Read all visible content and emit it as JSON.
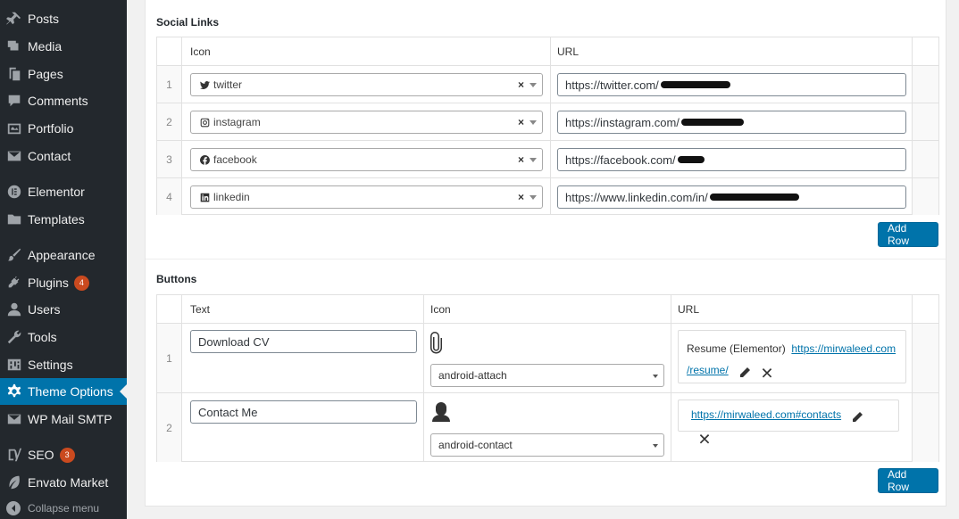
{
  "sidebar": {
    "items": [
      {
        "label": "Posts",
        "icon": "pushpin-icon"
      },
      {
        "label": "Media",
        "icon": "media-icon"
      },
      {
        "label": "Pages",
        "icon": "pages-icon"
      },
      {
        "label": "Comments",
        "icon": "comments-icon"
      },
      {
        "label": "Portfolio",
        "icon": "portfolio-icon"
      },
      {
        "label": "Contact",
        "icon": "envelope-icon"
      },
      {
        "label": "Elementor",
        "icon": "elementor-icon"
      },
      {
        "label": "Templates",
        "icon": "folder-icon"
      },
      {
        "label": "Appearance",
        "icon": "brush-icon"
      },
      {
        "label": "Plugins",
        "icon": "plug-icon",
        "badge": "4"
      },
      {
        "label": "Users",
        "icon": "user-icon"
      },
      {
        "label": "Tools",
        "icon": "wrench-icon"
      },
      {
        "label": "Settings",
        "icon": "settings-icon"
      },
      {
        "label": "Theme Options",
        "icon": "gear-icon",
        "active": true
      },
      {
        "label": "WP Mail SMTP",
        "icon": "mail-icon"
      },
      {
        "label": "SEO",
        "icon": "yoast-icon",
        "badge": "3"
      },
      {
        "label": "Envato Market",
        "icon": "leaf-icon"
      }
    ],
    "collapse_label": "Collapse menu"
  },
  "social": {
    "title": "Social Links",
    "col_icon": "Icon",
    "col_url": "URL",
    "rows": [
      {
        "num": "1",
        "icon_label": "twitter",
        "icon": "twitter-icon",
        "url": "https://twitter.com/"
      },
      {
        "num": "2",
        "icon_label": "instagram",
        "icon": "instagram-icon",
        "url": "https://instagram.com/"
      },
      {
        "num": "3",
        "icon_label": "facebook",
        "icon": "facebook-icon",
        "url": "https://facebook.com/"
      },
      {
        "num": "4",
        "icon_label": "linkedin",
        "icon": "linkedin-icon",
        "url": "https://www.linkedin.com/in/"
      }
    ],
    "clear_symbol": "×",
    "add_row": "Add Row"
  },
  "buttons": {
    "title": "Buttons",
    "col_text": "Text",
    "col_icon": "Icon",
    "col_url": "URL",
    "rows": [
      {
        "num": "1",
        "text": "Download CV",
        "icon_select": "android-attach",
        "icon": "paperclip-icon",
        "link_title": "Resume (Elementor)",
        "link_url_a": "https://mirwaleed.com",
        "link_url_b": "/resume/"
      },
      {
        "num": "2",
        "text": "Contact Me",
        "icon_select": "android-contact",
        "icon": "contact-icon",
        "link_url": "https://mirwaleed.com#contacts"
      }
    ],
    "add_row": "Add Row"
  },
  "colors": {
    "sidebar_bg": "#23282d",
    "active": "#0073aa",
    "badge": "#ca4a1f"
  }
}
